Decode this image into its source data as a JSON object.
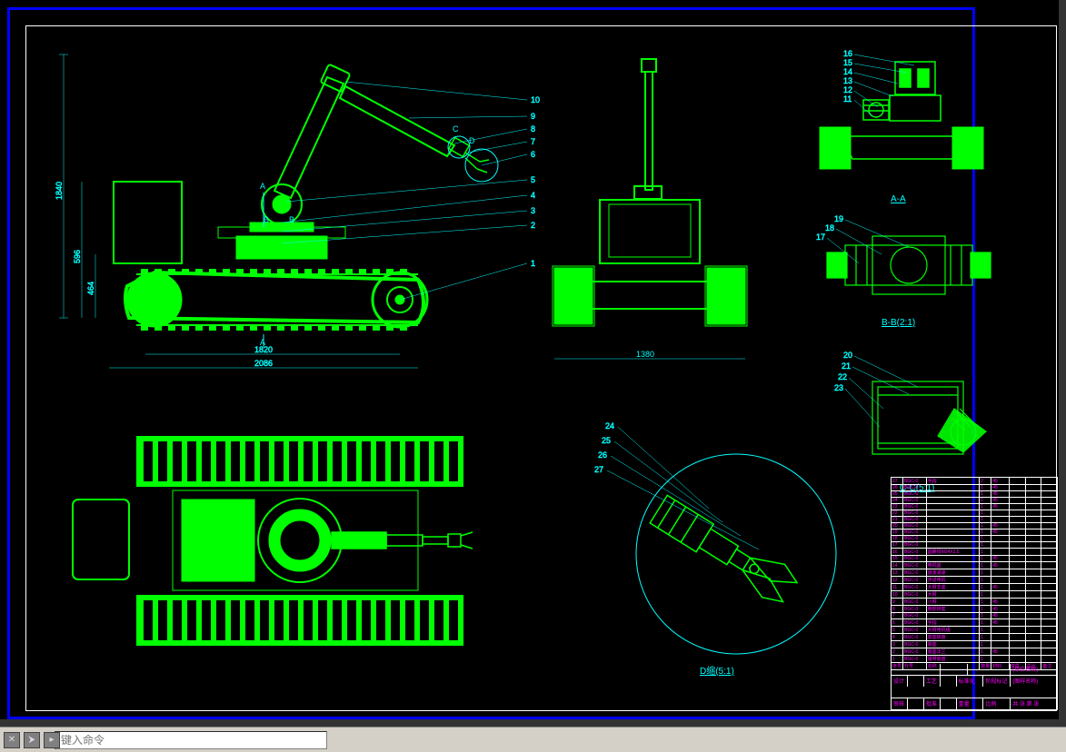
{
  "command_prompt": "键入命令",
  "dimensions": {
    "side_height_total": "1840",
    "side_height_body": "596",
    "side_height_track": "464",
    "side_length_wheelbase": "1820",
    "side_length_total": "2086",
    "front_width": "1380"
  },
  "callouts_side": [
    "10",
    "9",
    "8",
    "7",
    "6",
    "5",
    "4",
    "3",
    "2",
    "1"
  ],
  "callouts_aa": [
    "16",
    "15",
    "14",
    "13",
    "12",
    "11"
  ],
  "callouts_bb": [
    "19",
    "18",
    "17"
  ],
  "callouts_cc": [
    "20",
    "21",
    "22",
    "23"
  ],
  "callouts_d": [
    "24",
    "25",
    "26",
    "27"
  ],
  "section_labels": {
    "aa": "A-A",
    "bb": "B-B(2:1)",
    "cc": "C-C(5:1)",
    "d": "D缩(5:1)",
    "side_a_top": "A",
    "side_a_bot": "A",
    "side_b_top": "B",
    "side_b_bot": "B",
    "side_c": "C",
    "side_d": "D"
  },
  "bom_header": [
    "序号",
    "代号",
    "名称",
    "数量",
    "材料",
    "单件",
    "总计",
    "备注"
  ],
  "bom_rows": [
    {
      "n": "27",
      "c": "BGC-0",
      "name": "手指",
      "q": "2",
      "m": "45"
    },
    {
      "n": "26",
      "c": "BGC-0",
      "name": "",
      "q": "1",
      "m": "45"
    },
    {
      "n": "25",
      "c": "BGC-0",
      "name": "",
      "q": "1",
      "m": "45"
    },
    {
      "n": "24",
      "c": "BGC-0",
      "name": "",
      "q": "1",
      "m": "45"
    },
    {
      "n": "23",
      "c": "BGC-0",
      "name": "",
      "q": "1",
      "m": "45"
    },
    {
      "n": "22",
      "c": "BGC-0",
      "name": "",
      "q": "1",
      "m": ""
    },
    {
      "n": "21",
      "c": "BGC-0",
      "name": "",
      "q": "1",
      "m": ""
    },
    {
      "n": "20",
      "c": "BGC-0",
      "name": "",
      "q": "1",
      "m": "45"
    },
    {
      "n": "19",
      "c": "BGC-0",
      "name": "",
      "q": "1",
      "m": "45"
    },
    {
      "n": "18",
      "c": "BGC-0",
      "name": "",
      "q": "1",
      "m": ""
    },
    {
      "n": "17",
      "c": "BGC-0",
      "name": "",
      "q": "1",
      "m": ""
    },
    {
      "n": "16",
      "c": "BGC-0",
      "name": "圆螺母M24X1.5",
      "q": "1",
      "m": ""
    },
    {
      "n": "15",
      "c": "BGC-0",
      "name": "",
      "q": "1",
      "m": "45"
    },
    {
      "n": "14",
      "c": "BGC-0",
      "name": "电机座",
      "q": "1",
      "m": "45"
    },
    {
      "n": "13",
      "c": "BGC-0",
      "name": "谐波减速",
      "q": "1",
      "m": ""
    },
    {
      "n": "12",
      "c": "BGC-0",
      "name": "步进电机",
      "q": "1",
      "m": ""
    },
    {
      "n": "11",
      "c": "BGC-0",
      "name": "大臂支座",
      "q": "1",
      "m": "45"
    },
    {
      "n": "10",
      "c": "BGC-0",
      "name": "大臂",
      "q": "1",
      "m": ""
    },
    {
      "n": "9",
      "c": "BGC-0",
      "name": "小臂",
      "q": "1",
      "m": "45"
    },
    {
      "n": "8",
      "c": "BGC-0",
      "name": "腕部转套",
      "q": "1",
      "m": "45"
    },
    {
      "n": "7",
      "c": "BGC-0",
      "name": "",
      "q": "1",
      "m": "45"
    },
    {
      "n": "6",
      "c": "BGC-0",
      "name": "手指",
      "q": "1",
      "m": "45"
    },
    {
      "n": "5",
      "c": "BGC-0",
      "name": "大臂电机组",
      "q": "1",
      "m": ""
    },
    {
      "n": "4",
      "c": "BGC-0",
      "name": "底座转盘",
      "q": "1",
      "m": ""
    },
    {
      "n": "3",
      "c": "BGC-0",
      "name": "底座",
      "q": "1",
      "m": ""
    },
    {
      "n": "2",
      "c": "BGC-0",
      "name": "底座法兰",
      "q": "1",
      "m": "45"
    },
    {
      "n": "1",
      "c": "BGC-0",
      "name": "履带底盘",
      "q": "1",
      "m": ""
    }
  ],
  "title_block": {
    "unit_name": "(单位名称)",
    "drawing_name": "(图样名称)",
    "labels": [
      "设计",
      "审核",
      "工艺",
      "标准化",
      "批准",
      "日期",
      "比例",
      "共 张  第 张",
      "阶段标记",
      "重量"
    ]
  }
}
